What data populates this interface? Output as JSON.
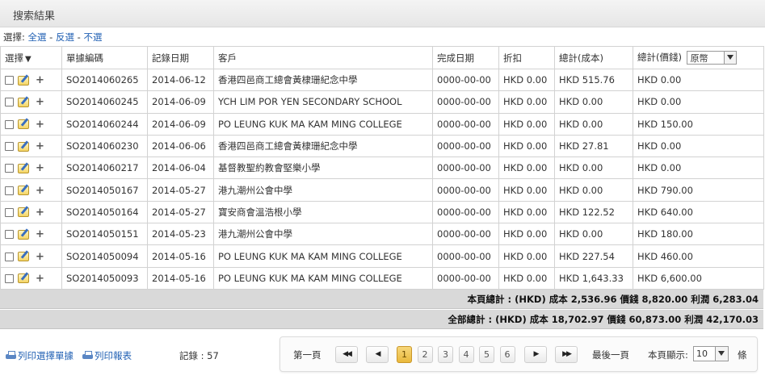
{
  "panel": {
    "title": "搜索結果"
  },
  "selection": {
    "label": "選擇:",
    "select_all": "全選",
    "sep1": " - ",
    "invert": "反選",
    "sep2": " - ",
    "select_none": "不選"
  },
  "columns": {
    "select": "選擇",
    "order_no": "單據編碼",
    "record_date": "記錄日期",
    "customer": "客戶",
    "finish_date": "完成日期",
    "discount": "折扣",
    "total_cost": "總計(成本)",
    "total_price": "總計(價錢)",
    "currency": "原幣"
  },
  "rows": [
    {
      "order_no": "SO2014060265",
      "record_date": "2014-06-12",
      "customer": "香港四邑商工總會黃棣珊紀念中學",
      "finish_date": "0000-00-00",
      "discount": "HKD 0.00",
      "total_cost": "HKD 515.76",
      "total_price": "HKD 0.00"
    },
    {
      "order_no": "SO2014060245",
      "record_date": "2014-06-09",
      "customer": "YCH LIM POR YEN SECONDARY SCHOOL",
      "finish_date": "0000-00-00",
      "discount": "HKD 0.00",
      "total_cost": "HKD 0.00",
      "total_price": "HKD 0.00"
    },
    {
      "order_no": "SO2014060244",
      "record_date": "2014-06-09",
      "customer": "PO LEUNG KUK MA KAM MING COLLEGE",
      "finish_date": "0000-00-00",
      "discount": "HKD 0.00",
      "total_cost": "HKD 0.00",
      "total_price": "HKD 150.00"
    },
    {
      "order_no": "SO2014060230",
      "record_date": "2014-06-06",
      "customer": "香港四邑商工總會黃棣珊紀念中學",
      "finish_date": "0000-00-00",
      "discount": "HKD 0.00",
      "total_cost": "HKD 27.81",
      "total_price": "HKD 0.00"
    },
    {
      "order_no": "SO2014060217",
      "record_date": "2014-06-04",
      "customer": "基督教聖約教會堅樂小學",
      "finish_date": "0000-00-00",
      "discount": "HKD 0.00",
      "total_cost": "HKD 0.00",
      "total_price": "HKD 0.00"
    },
    {
      "order_no": "SO2014050167",
      "record_date": "2014-05-27",
      "customer": "港九潮州公會中學",
      "finish_date": "0000-00-00",
      "discount": "HKD 0.00",
      "total_cost": "HKD 0.00",
      "total_price": "HKD 790.00"
    },
    {
      "order_no": "SO2014050164",
      "record_date": "2014-05-27",
      "customer": "寶安商會溫浩根小學",
      "finish_date": "0000-00-00",
      "discount": "HKD 0.00",
      "total_cost": "HKD 122.52",
      "total_price": "HKD 640.00"
    },
    {
      "order_no": "SO2014050151",
      "record_date": "2014-05-23",
      "customer": "港九潮州公會中學",
      "finish_date": "0000-00-00",
      "discount": "HKD 0.00",
      "total_cost": "HKD 0.00",
      "total_price": "HKD 180.00"
    },
    {
      "order_no": "SO2014050094",
      "record_date": "2014-05-16",
      "customer": "PO LEUNG KUK MA KAM MING COLLEGE",
      "finish_date": "0000-00-00",
      "discount": "HKD 0.00",
      "total_cost": "HKD 227.54",
      "total_price": "HKD 460.00"
    },
    {
      "order_no": "SO2014050093",
      "record_date": "2014-05-16",
      "customer": "PO LEUNG KUK MA KAM MING COLLEGE",
      "finish_date": "0000-00-00",
      "discount": "HKD 0.00",
      "total_cost": "HKD 1,643.33",
      "total_price": "HKD 6,600.00"
    }
  ],
  "summary": {
    "page_total": "本頁總計 : (HKD) 成本 2,536.96 價錢 8,820.00 利潤 6,283.04",
    "all_total": "全部總計 : (HKD) 成本 18,702.97 價錢 60,873.00 利潤 42,170.03"
  },
  "footer": {
    "print_selected": "列印選擇單據",
    "print_report": "列印報表",
    "records": "記錄 : 57",
    "first_page": "第一頁",
    "last_page": "最後一頁",
    "pages": [
      "1",
      "2",
      "3",
      "4",
      "5",
      "6"
    ],
    "active_page": "1",
    "per_page_label": "本頁顯示:",
    "per_page_value": "10",
    "per_page_unit": "條"
  }
}
